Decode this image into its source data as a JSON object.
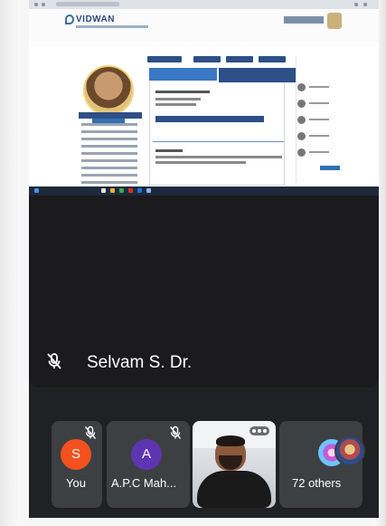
{
  "shared_screen": {
    "site_logo": "VIDWAN",
    "description": "Presented browser window showing a researcher profile page"
  },
  "speaker": {
    "name": "Selvam S. Dr.",
    "muted": true,
    "mic_icon": "mic-off-icon"
  },
  "participants": [
    {
      "label": "You",
      "initial": "S",
      "avatar_color": "#f4511e",
      "muted": true,
      "mic_icon": "mic-off-icon"
    },
    {
      "label": "A.P.C Mah...",
      "initial": "A",
      "avatar_color": "#5e35b1",
      "muted": true,
      "mic_icon": "mic-off-icon"
    },
    {
      "label": "",
      "type": "video",
      "menu_icon": "more-dots-icon"
    },
    {
      "label": "72 others",
      "type": "overflow"
    }
  ],
  "colors": {
    "meet_background": "#202124",
    "tile_background": "#3c4043",
    "site_accent": "#2b4f86"
  }
}
